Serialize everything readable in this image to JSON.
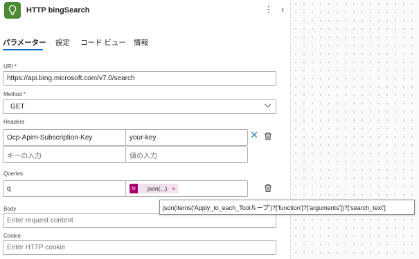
{
  "header": {
    "title": "HTTP bingSearch",
    "more_label": "⋮",
    "collapse_label": "‹"
  },
  "tabs": [
    {
      "label": "パラメーター",
      "active": true
    },
    {
      "label": "設定",
      "active": false
    },
    {
      "label": "コード ビュー",
      "active": false
    },
    {
      "label": "情報",
      "active": false
    }
  ],
  "fields": {
    "uri": {
      "label": "URI",
      "required": "*",
      "value": "https://api.bing.microsoft.com/v7.0/search"
    },
    "method": {
      "label": "Method",
      "required": "*",
      "value": "GET"
    },
    "headers": {
      "label": "Headers",
      "rows": [
        {
          "key": "Ocp-Apim-Subscription-Key",
          "value": "your-key"
        },
        {
          "key_placeholder": "キーの入力",
          "value_placeholder": "値の入力"
        }
      ]
    },
    "queries": {
      "label": "Queries",
      "key": "q",
      "token_icon": "fx",
      "token_label": "json(...)",
      "token_close": "×"
    },
    "body": {
      "label": "Body",
      "placeholder": "Enter request content"
    },
    "cookie": {
      "label": "Cookie",
      "placeholder": "Enter HTTP cookie"
    }
  },
  "tooltip": {
    "text": "json(items('Apply_to_each_Toolループ')?['function']?['arguments'])?['search_text']"
  },
  "colors": {
    "accent": "#0f6cbd",
    "app_icon": "#4a8a36",
    "token": "#a4006f",
    "token_bg": "#f3e1ee"
  },
  "icons": [
    "bulb-icon",
    "more-vertical-icon",
    "chevron-left-icon",
    "chevron-down-icon",
    "close-icon",
    "delete-icon",
    "function-icon"
  ]
}
